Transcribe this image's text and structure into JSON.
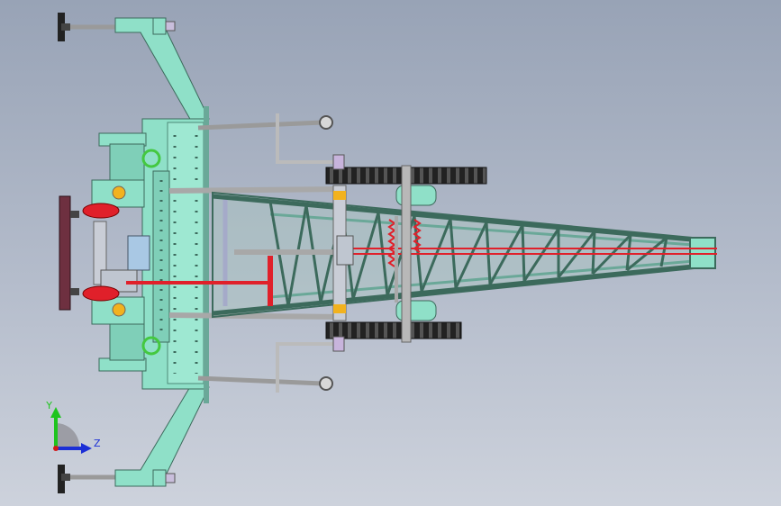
{
  "triad": {
    "y_label": "Y",
    "z_label": "Z",
    "y_color": "#1ec41e",
    "z_color": "#1b2fd6",
    "x_color": "#d21a1a"
  },
  "colors": {
    "frame": "#8fe0c8",
    "frame_dark": "#5fb79e",
    "gear": "#1a1a1a",
    "spring": "#e0202a",
    "bolt": "#c8b4dc",
    "shaft": "#a8a8a8",
    "accent": "#f2b21e",
    "plate": "#6e3040"
  }
}
